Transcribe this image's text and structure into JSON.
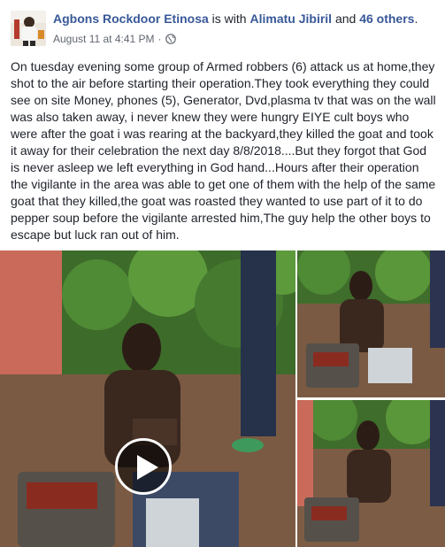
{
  "post": {
    "author": "Agbons Rockdoor Etinosa",
    "tag_prefix": " is with ",
    "tagged_person": "Alimatu Jibiril",
    "tag_and": " and ",
    "tagged_others": "46 others",
    "tag_suffix": ".",
    "timestamp": "August 11 at 4:41 PM",
    "separator": "·",
    "privacy_icon": "globe-icon",
    "text": "On tuesday evening some group of Armed robbers (6) attack us at home,they shot to the air before starting their operation.They took everything they could see on site Money, phones (5), Generator, Dvd,plasma tv that was on the wall was also taken away, i never knew they were hungry EIYE cult boys who were after the goat i was rearing at the backyard,they killed the goat and took it away for their celebration the next day 8/8/2018....But they forgot that God is never asleep we left everything in God hand...Hours after their operation the vigilante in the area was able to get one of them with the help of the same goat that they killed,the goat was roasted they wanted to use part of it to do pepper soup before the vigilante arrested him,The guy help the other boys to escape but luck ran out of him."
  },
  "media": {
    "play_icon": "play-icon"
  },
  "colors": {
    "link": "#385898",
    "text": "#1d2129",
    "meta": "#616770"
  }
}
